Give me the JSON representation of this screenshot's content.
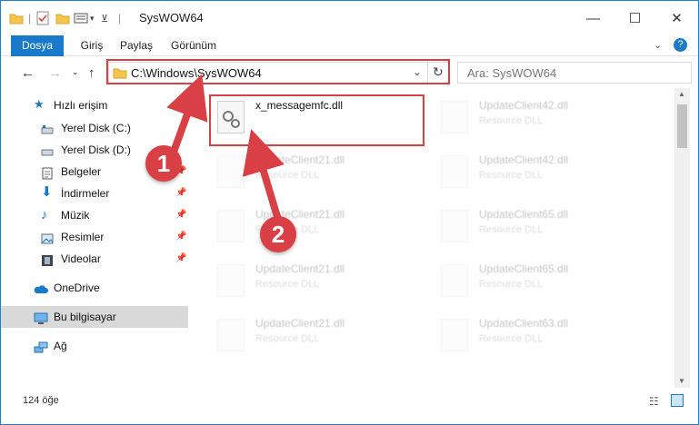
{
  "window": {
    "title": "SysWOW64",
    "minimize_icon": "minimize-icon",
    "maximize_icon": "maximize-icon",
    "close_icon": "close-icon"
  },
  "ribbon": {
    "tabs": [
      {
        "label": "Dosya"
      },
      {
        "label": "Giriş"
      },
      {
        "label": "Paylaş"
      },
      {
        "label": "Görünüm"
      }
    ]
  },
  "address": {
    "path": "C:\\Windows\\SysWOW64",
    "search_placeholder": "Ara: SysWOW64"
  },
  "sidebar": {
    "items": [
      {
        "label": "Hızlı erişim",
        "icon": "star-icon",
        "pinned": false
      },
      {
        "label": "Yerel Disk (C:)",
        "icon": "drive-icon",
        "pinned": false
      },
      {
        "label": "Yerel Disk (D:)",
        "icon": "drive-icon",
        "pinned": false
      },
      {
        "label": "Belgeler",
        "icon": "document-icon",
        "pinned": true
      },
      {
        "label": "İndirmeler",
        "icon": "download-icon",
        "pinned": true
      },
      {
        "label": "Müzik",
        "icon": "music-icon",
        "pinned": true
      },
      {
        "label": "Resimler",
        "icon": "pictures-icon",
        "pinned": true
      },
      {
        "label": "Videolar",
        "icon": "video-icon",
        "pinned": true
      },
      {
        "label": "OneDrive",
        "icon": "cloud-icon",
        "pinned": false
      },
      {
        "label": "Bu bilgisayar",
        "icon": "computer-icon",
        "pinned": false
      },
      {
        "label": "Ağ",
        "icon": "network-icon",
        "pinned": false
      }
    ]
  },
  "files": [
    {
      "name": "x_messagemfc.dll",
      "type": ""
    },
    {
      "name": "UpdateClient42.dll",
      "type": "Resource DLL"
    },
    {
      "name": "UpdateClient21.dll",
      "type": "Resource DLL"
    },
    {
      "name": "UpdateClient42.dll",
      "type": "Resource DLL"
    },
    {
      "name": "UpdateClient21.dll",
      "type": "Resource DLL"
    },
    {
      "name": "UpdateClient65.dll",
      "type": "Resource DLL"
    },
    {
      "name": "UpdateClient21.dll",
      "type": "Resource DLL"
    },
    {
      "name": "UpdateClient65.dll",
      "type": "Resource DLL"
    },
    {
      "name": "UpdateClient21.dll",
      "type": "Resource DLL"
    },
    {
      "name": "UpdateClient63.dll",
      "type": "Resource DLL"
    }
  ],
  "status": {
    "item_count": "124 öğe"
  },
  "annotations": {
    "step1": "1",
    "step2": "2",
    "color": "#d94045"
  }
}
